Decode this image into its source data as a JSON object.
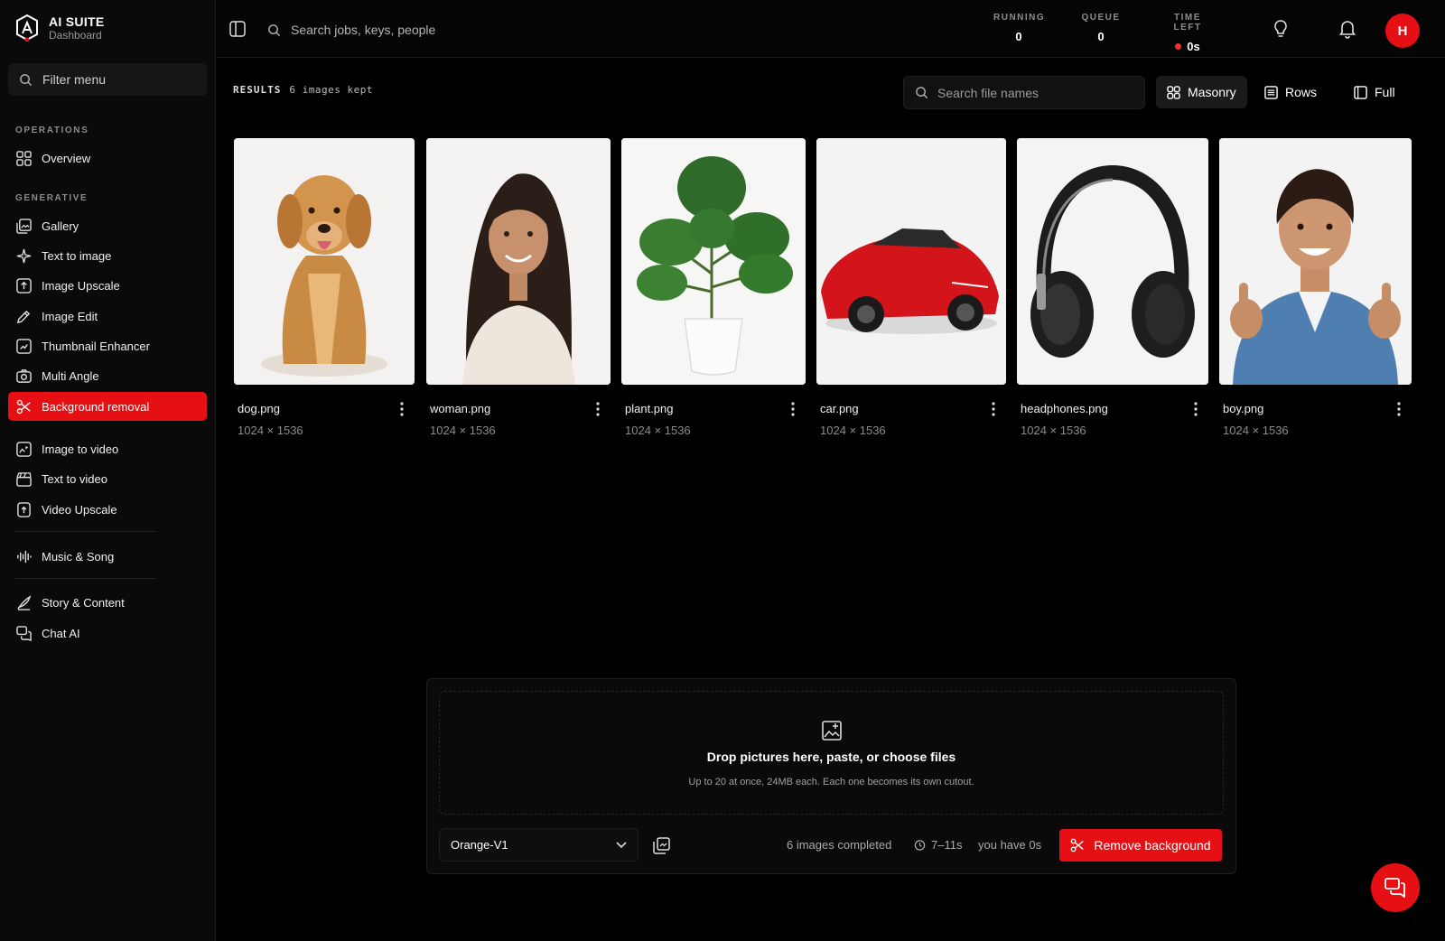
{
  "brand": {
    "title": "AI SUITE",
    "subtitle": "Dashboard"
  },
  "sidebar": {
    "filter_placeholder": "Filter menu",
    "sections": {
      "operations": "OPERATIONS",
      "generative": "GENERATIVE"
    },
    "items": [
      {
        "label": "Overview",
        "icon": "grid-icon"
      },
      {
        "label": "Gallery",
        "icon": "gallery-icon"
      },
      {
        "label": "Text to image",
        "icon": "sparkle-icon"
      },
      {
        "label": "Image Upscale",
        "icon": "upscale-icon"
      },
      {
        "label": "Image Edit",
        "icon": "pen-icon"
      },
      {
        "label": "Thumbnail Enhancer",
        "icon": "thumbnail-icon"
      },
      {
        "label": "Multi Angle",
        "icon": "camera-icon"
      },
      {
        "label": "Background removal",
        "icon": "scissors-icon",
        "active": true
      },
      {
        "label": "Image to video",
        "icon": "image-video-icon"
      },
      {
        "label": "Text to video",
        "icon": "clapper-icon"
      },
      {
        "label": "Video Upscale",
        "icon": "video-upscale-icon"
      },
      {
        "label": "Music & Song",
        "icon": "waveform-icon"
      },
      {
        "label": "Story & Content",
        "icon": "quill-icon"
      },
      {
        "label": "Chat AI",
        "icon": "chat-icon"
      }
    ]
  },
  "topbar": {
    "search_placeholder": "Search jobs, keys, people",
    "stats": {
      "running_label": "RUNNING",
      "running_value": "0",
      "queue_label": "QUEUE",
      "queue_value": "0",
      "time_label": "TIME LEFT",
      "time_value": "0s"
    },
    "avatar_initial": "H"
  },
  "results": {
    "label": "RESULTS",
    "count_text": "6 images kept",
    "search_placeholder": "Search file names",
    "views": {
      "masonry": "Masonry",
      "rows": "Rows",
      "full": "Full",
      "active": "Masonry"
    },
    "images": [
      {
        "name": "dog.png",
        "dims": "1024 × 1536"
      },
      {
        "name": "woman.png",
        "dims": "1024 × 1536"
      },
      {
        "name": "plant.png",
        "dims": "1024 × 1536"
      },
      {
        "name": "car.png",
        "dims": "1024 × 1536"
      },
      {
        "name": "headphones.png",
        "dims": "1024 × 1536"
      },
      {
        "name": "boy.png",
        "dims": "1024 × 1536"
      }
    ]
  },
  "upload": {
    "title": "Drop pictures here, paste, or choose files",
    "subtitle": "Up to 20 at once, 24MB each. Each one becomes its own cutout.",
    "model": "Orange-V1",
    "completed": "6 images completed",
    "eta": "7–11s",
    "credits": "you have 0s",
    "action": "Remove background"
  },
  "colors": {
    "accent": "#e60f14",
    "bg": "#000000",
    "sidebar": "#0a0a0a"
  }
}
